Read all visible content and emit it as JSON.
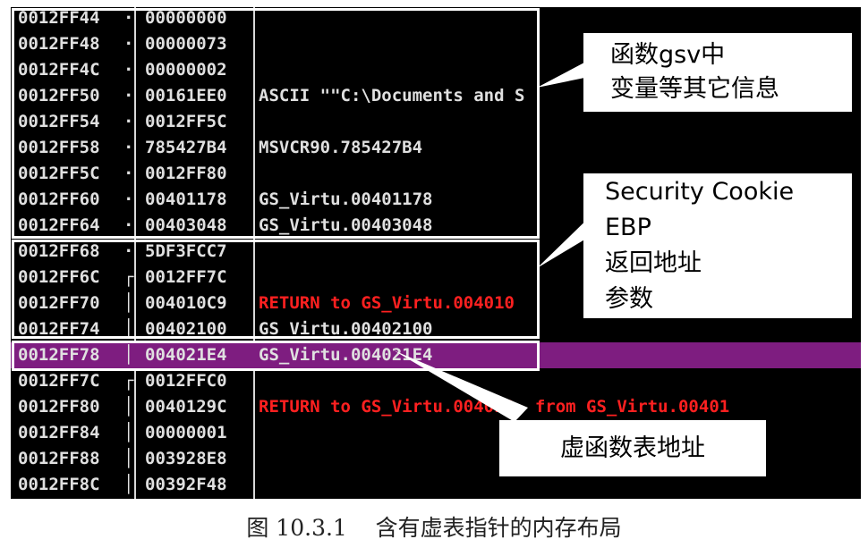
{
  "stack_rows": [
    {
      "address": "0012FF44",
      "marker": "·",
      "value": "00000000",
      "comment": "",
      "style": "normal"
    },
    {
      "address": "0012FF48",
      "marker": "·",
      "value": "00000073",
      "comment": "",
      "style": "normal"
    },
    {
      "address": "0012FF4C",
      "marker": "·",
      "value": "00000002",
      "comment": "",
      "style": "normal"
    },
    {
      "address": "0012FF50",
      "marker": "·",
      "value": "00161EE0",
      "comment": "ASCII \"\"C:\\Documents and S",
      "style": "normal"
    },
    {
      "address": "0012FF54",
      "marker": "·",
      "value": "0012FF5C",
      "comment": "",
      "style": "normal"
    },
    {
      "address": "0012FF58",
      "marker": "·",
      "value": "785427B4",
      "comment": "MSVCR90.785427B4",
      "style": "normal"
    },
    {
      "address": "0012FF5C",
      "marker": "·",
      "value": "0012FF80",
      "comment": "",
      "style": "normal"
    },
    {
      "address": "0012FF60",
      "marker": "·",
      "value": "00401178",
      "comment": "GS_Virtu.00401178",
      "style": "normal"
    },
    {
      "address": "0012FF64",
      "marker": "·",
      "value": "00403048",
      "comment": "GS_Virtu.00403048",
      "style": "normal"
    },
    {
      "address": "0012FF68",
      "marker": "·",
      "value": "5DF3FCC7",
      "comment": "",
      "style": "normal"
    },
    {
      "address": "0012FF6C",
      "marker": "┌",
      "value": "0012FF7C",
      "comment": "",
      "style": "normal"
    },
    {
      "address": "0012FF70",
      "marker": "│",
      "value": "004010C9",
      "comment": "RETURN to GS_Virtu.004010",
      "style": "red"
    },
    {
      "address": "0012FF74",
      "marker": "│",
      "value": "00402100",
      "comment": "GS_Virtu.00402100",
      "style": "normal"
    },
    {
      "address": "0012FF78",
      "marker": "│",
      "value": "004021E4",
      "comment": "GS_Virtu.004021E4",
      "style": "highlight"
    },
    {
      "address": "0012FF7C",
      "marker": "┌",
      "value": "0012FFC0",
      "comment": "",
      "style": "normal"
    },
    {
      "address": "0012FF80",
      "marker": "│",
      "value": "0040129C",
      "comment": "RETURN to GS_Virtu.004012  from GS_Virtu.00401",
      "style": "red"
    },
    {
      "address": "0012FF84",
      "marker": "│",
      "value": "00000001",
      "comment": "",
      "style": "normal"
    },
    {
      "address": "0012FF88",
      "marker": "│",
      "value": "003928E8",
      "comment": "",
      "style": "normal"
    },
    {
      "address": "0012FF8C",
      "marker": "│",
      "value": "00392F48",
      "comment": "",
      "style": "normal"
    }
  ],
  "callouts": {
    "locals": [
      "函数gsv中",
      "变量等其它信息"
    ],
    "frame": [
      "Security Cookie",
      "EBP",
      "返回地址",
      "参数"
    ],
    "vtable": [
      "虚函数表地址"
    ]
  },
  "caption": {
    "label": "图 10.3.1",
    "text": "含有虚表指针的内存布局"
  },
  "colors": {
    "background": "#000000",
    "text": "#e0e0e0",
    "return_text": "#ff2020",
    "highlight_row": "#7e1d80"
  }
}
